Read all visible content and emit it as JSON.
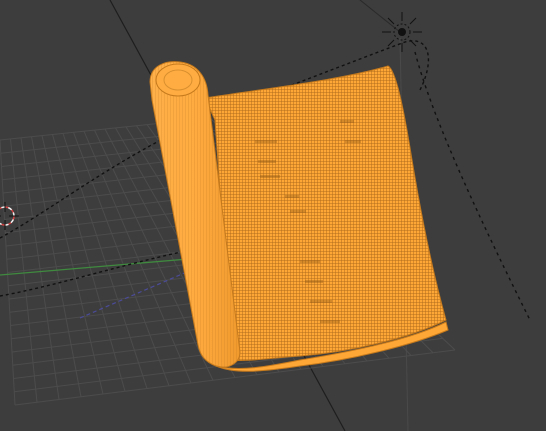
{
  "viewport": {
    "background": "#3d3d3d",
    "grid_color": "#4a4a4a",
    "axis_x_color": "#3f8a3f",
    "axis_y_color": "#4a4a8a",
    "wire_color": "#ffa736",
    "wire_shadow": "#c67a1c",
    "wire_light": "#ffd08a"
  },
  "objects": {
    "selected_mesh": "rolled-scroll-mesh",
    "lamp": "sun-lamp-icon",
    "cursor": "3d-cursor-icon",
    "curve": "dashed-path-curve"
  }
}
